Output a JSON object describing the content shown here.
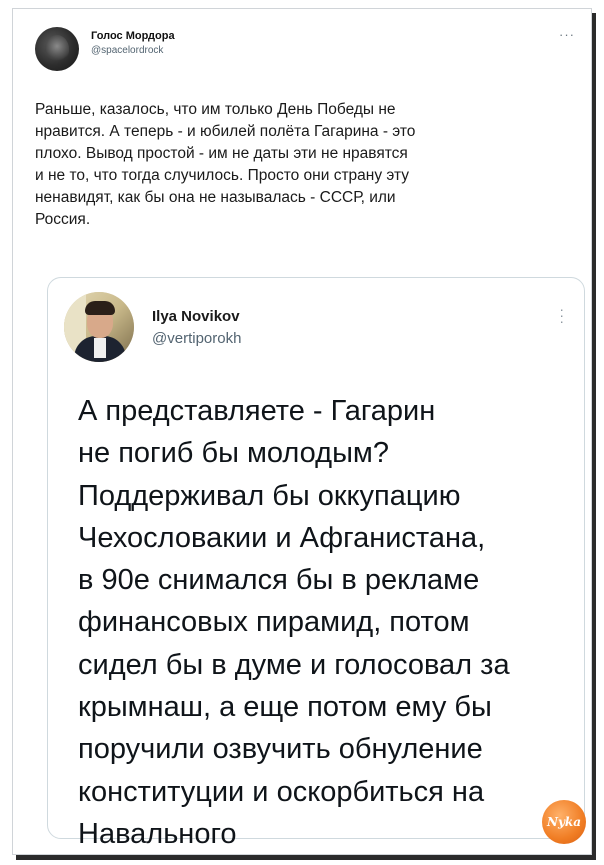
{
  "outer_tweet": {
    "author_name": "Голос Мордора",
    "author_handle": "@spacelordrock",
    "more_icon": "more-dots-icon",
    "text": "Раньше, казалось, что им только День Победы не\nнравится. А теперь - и юбилей полёта Гагарина - это\nплохо. Вывод простой - им не даты эти не нравятся\nи не то, что тогда случилось. Просто они страну эту\nненавидят, как бы она не называлась - СССР, или\nРоссия."
  },
  "quoted_tweet": {
    "author_name": "Ilya Novikov",
    "author_handle": "@vertiporokh",
    "more_icon": "more-vertical-icon",
    "text": "А представляете - Гагарин\nне погиб бы молодым?\nПоддерживал бы оккупацию\nЧехословакии и Афганистана,\nв 90е снимался бы в рекламе\nфинансовых пирамид, потом\nсидел бы в думе и голосовал за\nкрымнаш, а еще потом ему бы\nпоручили озвучить обнуление\nконституции и оскорбиться на\nНавального"
  },
  "watermark": {
    "label": "Nyka"
  },
  "colors": {
    "text": "#0f1419",
    "secondary": "#536471",
    "border": "#cfd9de",
    "watermark": "#f07d24"
  }
}
